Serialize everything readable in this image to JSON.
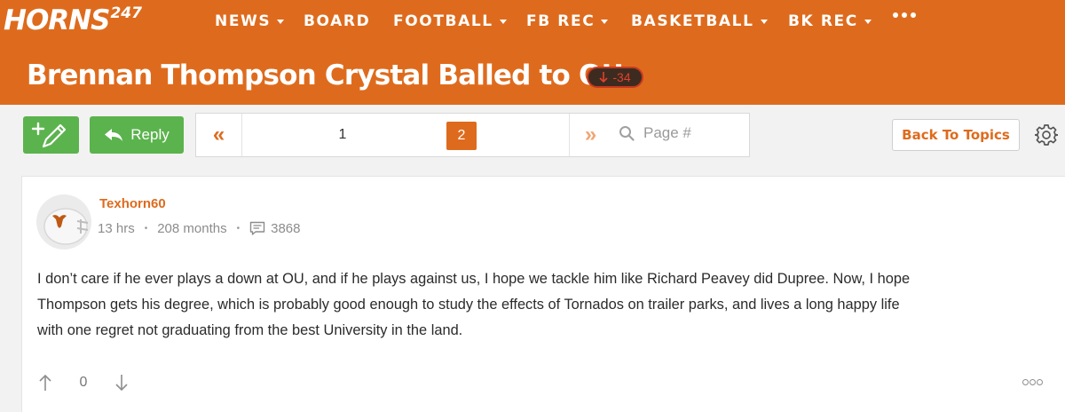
{
  "brand": {
    "logo_text": "HORNS",
    "logo_sup": "247",
    "color": "#de6b1d"
  },
  "nav": {
    "items": [
      {
        "label": "NEWS",
        "dropdown": true
      },
      {
        "label": "BOARD",
        "dropdown": false
      },
      {
        "label": "FOOTBALL",
        "dropdown": true
      },
      {
        "label": "FB REC",
        "dropdown": true
      },
      {
        "label": "BASKETBALL",
        "dropdown": true
      },
      {
        "label": "BK REC",
        "dropdown": true
      }
    ],
    "more_icon": "ellipsis-icon"
  },
  "thread": {
    "title": "Brennan Thompson Crystal Balled to OU",
    "vote_score": "-34",
    "vote_icon": "arrow-down-icon"
  },
  "toolbar": {
    "new_post_icon": "pencil-plus-icon",
    "reply_label": "Reply",
    "reply_icon": "reply-arrow-icon",
    "pagination": {
      "prev": "«",
      "pages": [
        "1",
        "2"
      ],
      "current_page": "2",
      "next": "»",
      "page_input_placeholder": "Page #"
    },
    "back_label": "Back To Topics",
    "settings_icon": "gear-icon"
  },
  "post": {
    "username": "Texhorn60",
    "posted": "13 hrs",
    "membership": "208 months",
    "post_count": "3868",
    "body_lines": [
      "I don’t care if he ever plays a down at OU, and if he plays against us, I hope we tackle him like Richard Peavey did Dupree. Now, I hope",
      "Thompson gets his degree, which is probably good enough to study the effects of Tornados on trailer parks, and lives a long happy life",
      "with one regret not graduating from the best University in the land."
    ],
    "vote_count": "0"
  },
  "colors": {
    "accent": "#de6b1d",
    "green": "#5bb34d",
    "negative": "#e2412c"
  }
}
